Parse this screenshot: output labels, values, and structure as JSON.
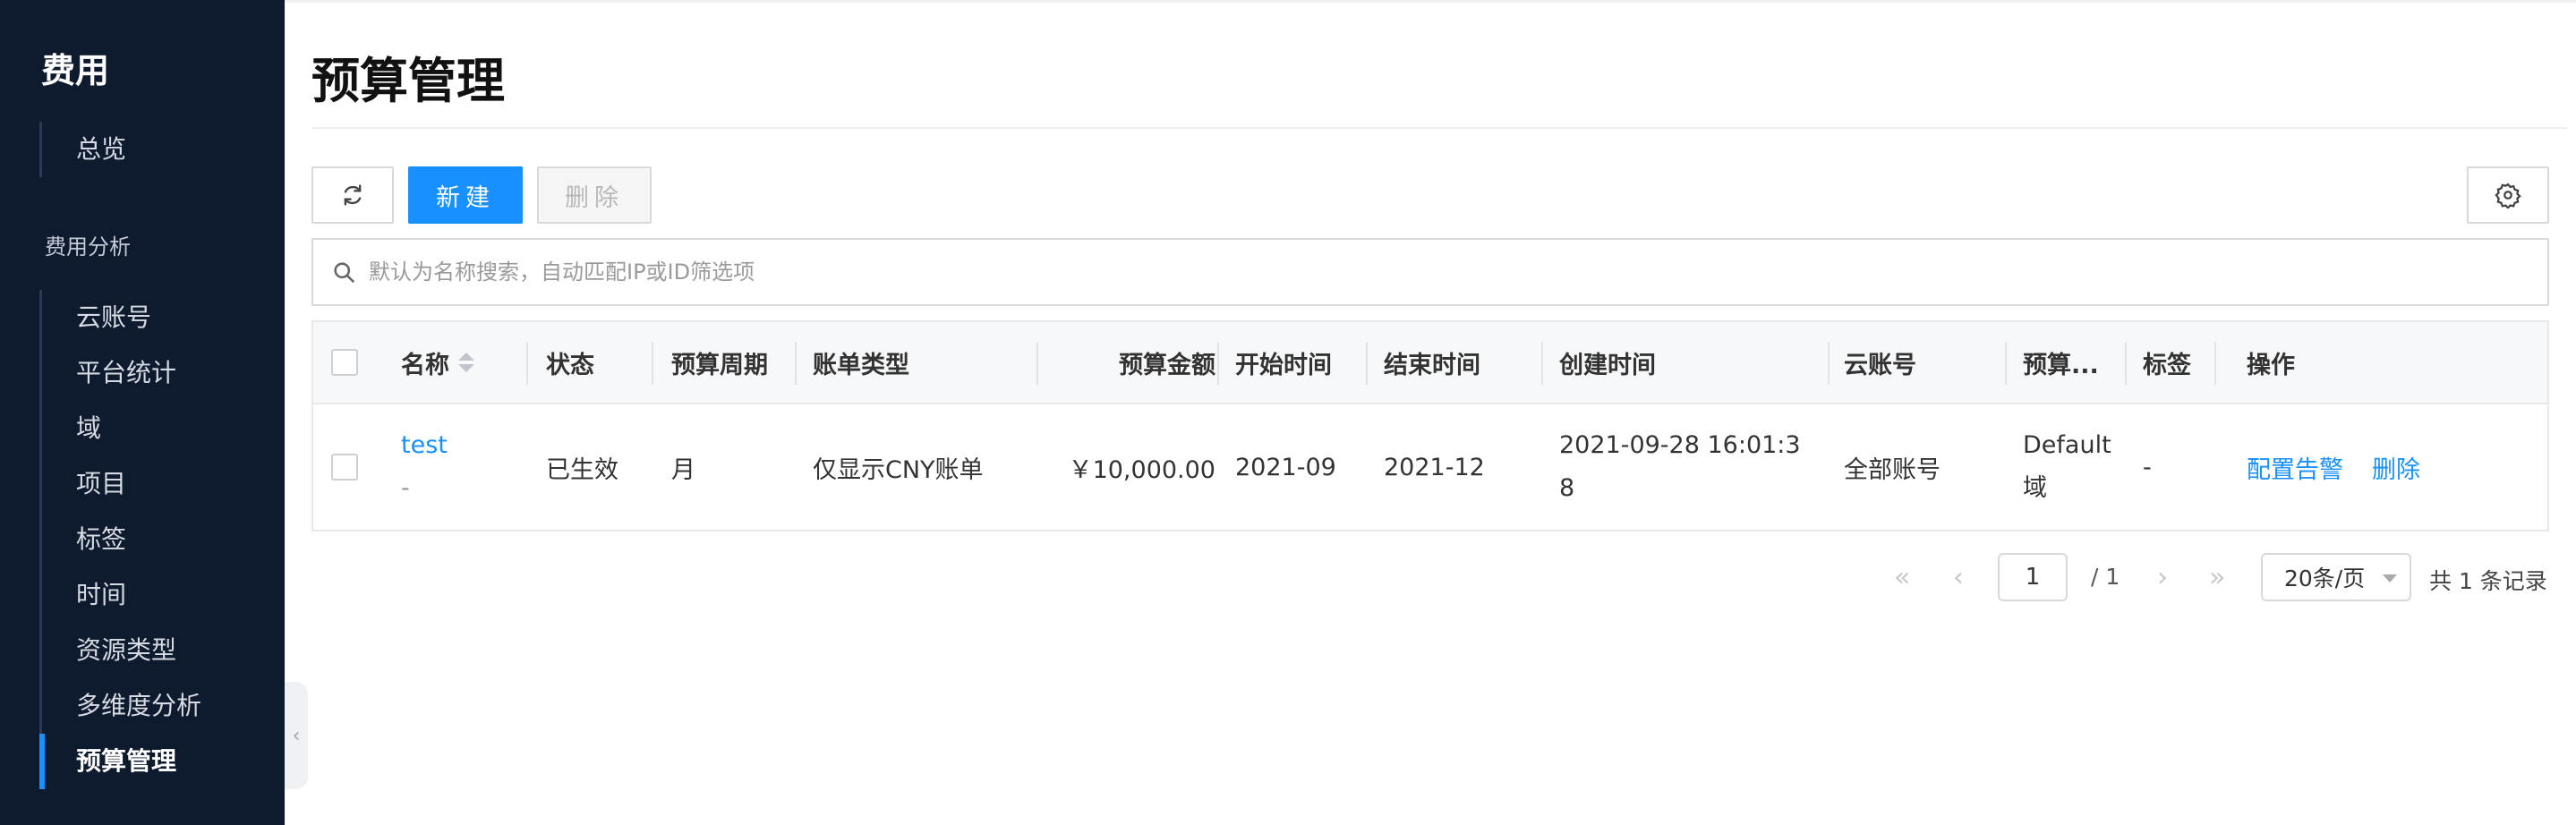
{
  "sidebar": {
    "title": "费用",
    "top_items": [
      {
        "label": "总览"
      }
    ],
    "section_label": "费用分析",
    "items": [
      {
        "label": "云账号"
      },
      {
        "label": "平台统计"
      },
      {
        "label": "域"
      },
      {
        "label": "项目"
      },
      {
        "label": "标签"
      },
      {
        "label": "时间"
      },
      {
        "label": "资源类型"
      },
      {
        "label": "多维度分析"
      },
      {
        "label": "预算管理",
        "active": true
      }
    ],
    "collapse_glyph": "‹"
  },
  "page": {
    "title": "预算管理"
  },
  "toolbar": {
    "refresh_icon": "refresh-icon",
    "new_label": "新建",
    "delete_label": "删除",
    "settings_icon": "gear-icon"
  },
  "search": {
    "placeholder": "默认为名称搜索，自动匹配IP或ID筛选项",
    "value": ""
  },
  "table": {
    "headers": {
      "name": "名称",
      "status": "状态",
      "period": "预算周期",
      "bill_type": "账单类型",
      "amount": "预算金额",
      "start": "开始时间",
      "end": "结束时间",
      "created": "创建时间",
      "account": "云账号",
      "domain": "预算...",
      "tags": "标签",
      "actions": "操作"
    },
    "rows": [
      {
        "name": "test",
        "description": "-",
        "status": "已生效",
        "period": "月",
        "bill_type": "仅显示CNY账单",
        "amount": "￥10,000.00",
        "start": "2021-09",
        "end": "2021-12",
        "created_line1": "2021-09-28 16:01:3",
        "created_line2": "8",
        "account": "全部账号",
        "domain_line1": "Default",
        "domain_line2": "域",
        "tags": "-",
        "action_alert": "配置告警",
        "action_delete": "删除"
      }
    ]
  },
  "pagination": {
    "first_glyph": "«",
    "prev_glyph": "‹",
    "next_glyph": "›",
    "last_glyph": "»",
    "current_page": "1",
    "total_pages": "/ 1",
    "page_size": "20条/页",
    "record_count": "共 1 条记录"
  },
  "colors": {
    "primary": "#1890ff",
    "sidebar_bg": "#0e1a2e"
  }
}
